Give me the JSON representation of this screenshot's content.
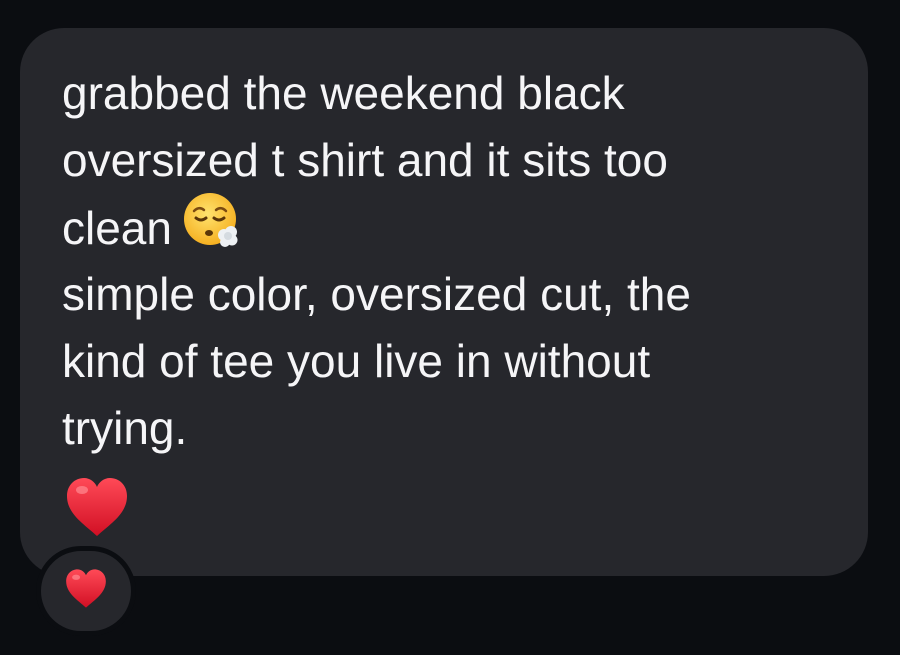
{
  "message": {
    "lines": [
      "grabbed the weekend black",
      "oversized t shirt and it sits too",
      "clean",
      "simple color, oversized cut, the",
      "kind of tee you live in without",
      "trying."
    ],
    "inline_emoji": "face-exhaling-icon",
    "trailing_emoji": "red-heart-icon"
  },
  "reaction": {
    "emoji": "red-heart-icon"
  },
  "colors": {
    "background": "#0b0d11",
    "bubble": "#26272c",
    "text": "#f5f5f7",
    "heart": "#e0182d"
  }
}
